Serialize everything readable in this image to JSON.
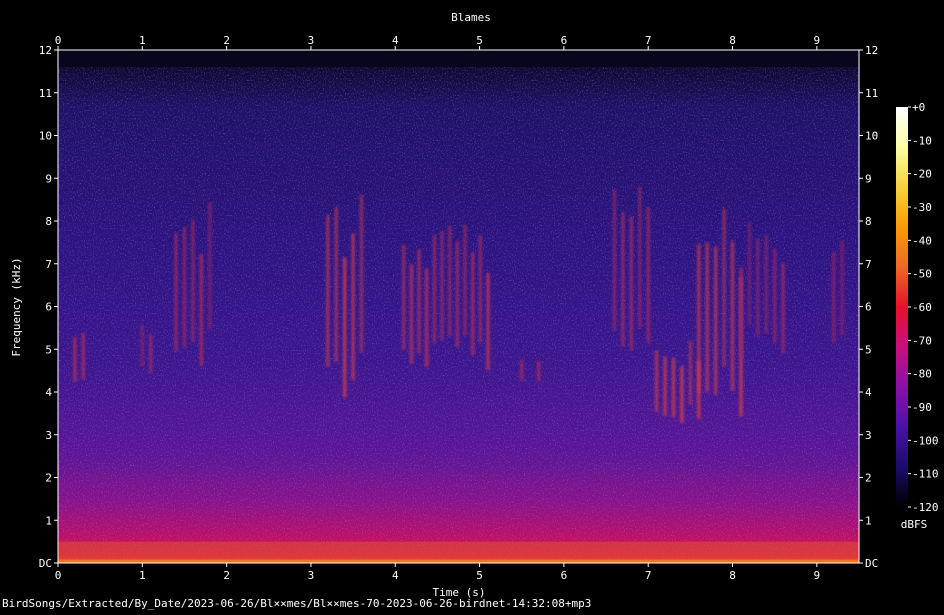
{
  "chart_data": {
    "type": "heatmap",
    "title": "Blames",
    "xlabel": "Time (s)",
    "ylabel": "Frequency (kHz)",
    "x_range": [
      0,
      9.5
    ],
    "y_range": [
      0,
      12
    ],
    "x_ticks": [
      "0",
      "1",
      "2",
      "3",
      "4",
      "5",
      "6",
      "7",
      "8",
      "9"
    ],
    "y_ticks": [
      "DC",
      "1",
      "2",
      "3",
      "4",
      "5",
      "6",
      "7",
      "8",
      "9",
      "10",
      "11",
      "12"
    ],
    "colorbar": {
      "label": "dBFS",
      "range": [
        -120,
        0
      ],
      "ticks": [
        "+0",
        "-10",
        "-20",
        "-30",
        "-40",
        "-50",
        "-60",
        "-70",
        "-80",
        "-90",
        "-100",
        "-110",
        "-120"
      ],
      "colormap": [
        "#000000",
        "#1b0c41",
        "#4a0c6b",
        "#781c6d",
        "#a52c60",
        "#cf4446",
        "#ed6925",
        "#fb9b06",
        "#f7d13d",
        "#fcffa4",
        "#ffffff"
      ]
    },
    "background_noise_dbfs": -100,
    "low_frequency_energy_dbfs": -55,
    "dc_band_dbfs": -45,
    "calls": [
      {
        "t_start": 0.2,
        "t_end": 0.3,
        "f_low": 4.2,
        "f_high": 5.8,
        "level_dbfs": -72
      },
      {
        "t_start": 1.0,
        "t_end": 1.1,
        "f_low": 4.3,
        "f_high": 5.6,
        "level_dbfs": -74
      },
      {
        "t_start": 1.4,
        "t_end": 1.8,
        "f_low": 4.5,
        "f_high": 8.5,
        "level_dbfs": -74
      },
      {
        "t_start": 3.2,
        "t_end": 3.6,
        "f_low": 3.8,
        "f_high": 8.8,
        "level_dbfs": -65
      },
      {
        "t_start": 4.1,
        "t_end": 5.1,
        "f_low": 4.5,
        "f_high": 8.0,
        "level_dbfs": -70
      },
      {
        "t_start": 5.5,
        "t_end": 5.7,
        "f_low": 4.2,
        "f_high": 4.9,
        "level_dbfs": -74
      },
      {
        "t_start": 6.6,
        "t_end": 7.0,
        "f_low": 4.5,
        "f_high": 9.0,
        "level_dbfs": -72
      },
      {
        "t_start": 7.1,
        "t_end": 7.6,
        "f_low": 3.2,
        "f_high": 5.2,
        "level_dbfs": -62
      },
      {
        "t_start": 7.6,
        "t_end": 8.1,
        "f_low": 3.4,
        "f_high": 8.4,
        "level_dbfs": -64
      },
      {
        "t_start": 8.1,
        "t_end": 8.6,
        "f_low": 4.8,
        "f_high": 8.0,
        "level_dbfs": -76
      },
      {
        "t_start": 9.2,
        "t_end": 9.3,
        "f_low": 5.0,
        "f_high": 8.2,
        "level_dbfs": -80
      }
    ]
  },
  "caption": "BirdSongs/Extracted/By_Date/2023-06-26/Bl××mes/Bl××mes-70-2023-06-26-birdnet-14:32:08+mp3"
}
